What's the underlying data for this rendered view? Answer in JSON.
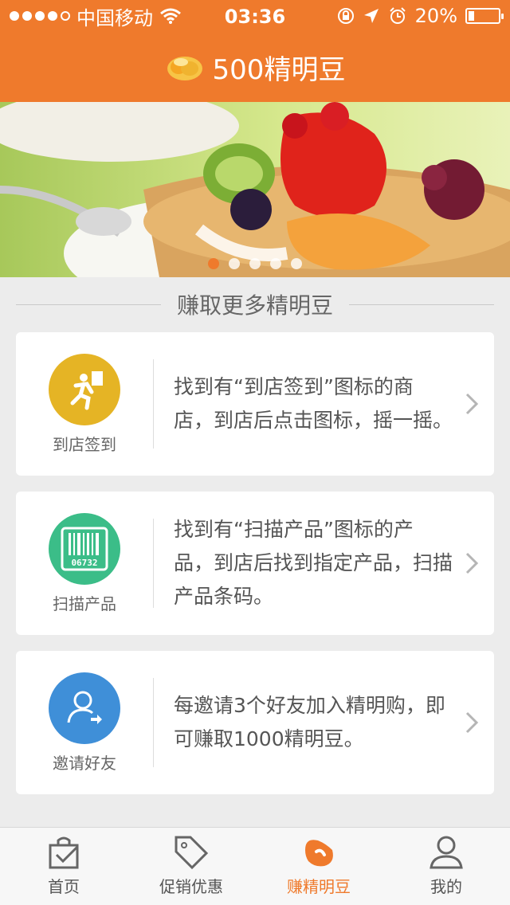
{
  "status_bar": {
    "carrier": "中国移动",
    "time": "03:36",
    "battery": "20%",
    "battery_level": 0.2
  },
  "nav": {
    "title": "500精明豆"
  },
  "banner": {
    "slides": 5,
    "active_slide": 1
  },
  "section": {
    "title": "赚取更多精明豆"
  },
  "cards": [
    {
      "label": "到店签到",
      "desc": "找到有“到店签到”图标的商店，到店后点击图标，摇一摇。",
      "icon": "running-person-icon",
      "color": "#e5b425"
    },
    {
      "label": "扫描产品",
      "desc": "找到有“扫描产品”图标的产品，到店后找到指定产品，扫描产品条码。",
      "icon": "barcode-icon",
      "barcode_text": "06732",
      "color": "#3bbd88"
    },
    {
      "label": "邀请好友",
      "desc": "每邀请3个好友加入精明购，即可赚取1000精明豆。",
      "icon": "invite-person-icon",
      "color": "#3f8fd8"
    }
  ],
  "tabs": [
    {
      "label": "首页",
      "icon": "home-bag-icon",
      "active": false
    },
    {
      "label": "促销优惠",
      "icon": "price-tag-icon",
      "active": false
    },
    {
      "label": "赚精明豆",
      "icon": "bean-icon",
      "active": true
    },
    {
      "label": "我的",
      "icon": "person-icon",
      "active": false
    }
  ],
  "colors": {
    "accent": "#ef7a2c"
  }
}
